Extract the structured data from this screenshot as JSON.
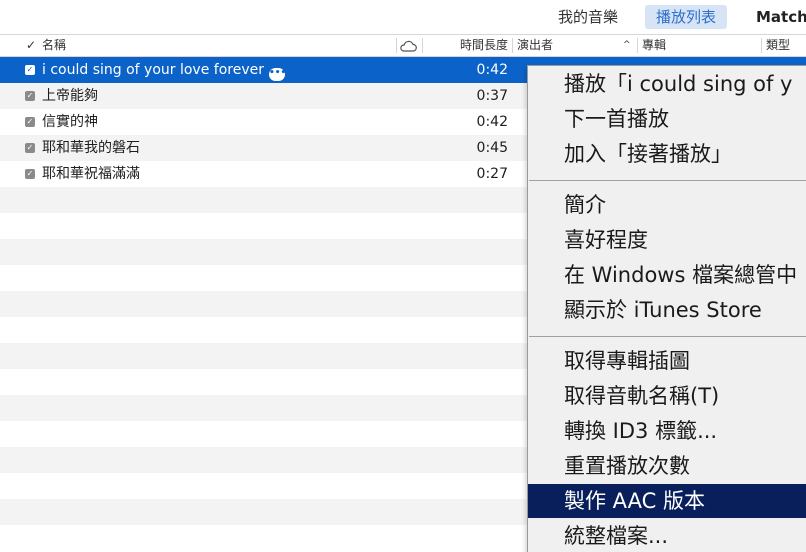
{
  "nav": {
    "library": "我的音樂",
    "playlists": "播放列表",
    "match": "Match"
  },
  "columns": {
    "check": "✓",
    "name": "名稱",
    "time": "時間長度",
    "artist": "演出者",
    "album": "專輯",
    "genre": "類型"
  },
  "icons": {
    "cloud": "cloud-icon",
    "checkbox": "checkbox-icon",
    "more": "more-options-icon",
    "sort": "sort-ascending-icon"
  },
  "tracks": [
    {
      "name": "i could sing of your love forever",
      "time": "0:42",
      "selected": true
    },
    {
      "name": "上帝能夠",
      "time": "0:37",
      "selected": false
    },
    {
      "name": "信實的神",
      "time": "0:42",
      "selected": false
    },
    {
      "name": "耶和華我的磐石",
      "time": "0:45",
      "selected": false
    },
    {
      "name": "耶和華祝福滿滿",
      "time": "0:27",
      "selected": false
    }
  ],
  "context_menu": {
    "items": [
      "播放「i could sing of y",
      "下一首播放",
      "加入「接著播放」",
      "簡介",
      "喜好程度",
      "在 Windows 檔案總管中",
      "顯示於 iTunes Store",
      "取得專輯插圖",
      "取得音軌名稱(T)",
      "轉換 ID3 標籤...",
      "重置播放次數",
      "製作 AAC 版本",
      "統整檔案..."
    ],
    "highlighted_index": 11
  },
  "colors": {
    "selection": "#0b63c9",
    "menu_highlight": "#091f5c",
    "nav_active_bg": "#d6e4f6",
    "nav_active_text": "#2f6fc9"
  }
}
